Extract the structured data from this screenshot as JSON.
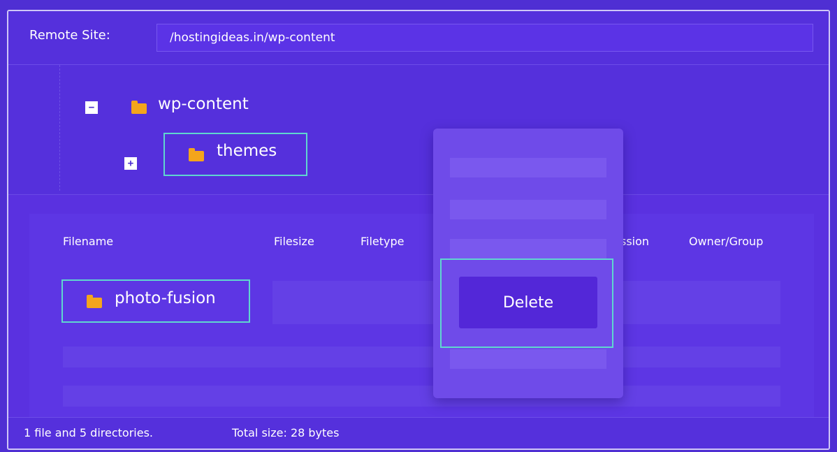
{
  "remote_site": {
    "label": "Remote Site:",
    "path": "/hostingideas.in/wp-content"
  },
  "tree": {
    "root": {
      "toggle": "−",
      "label": "wp-content",
      "icon": "folder-icon"
    },
    "child": {
      "toggle": "+",
      "label": "themes",
      "icon": "folder-icon"
    }
  },
  "file_list": {
    "columns": [
      "Filename",
      "Filesize",
      "Filetype",
      "ssion",
      "Owner/Group"
    ],
    "rows": [
      {
        "filename": "photo-fusion",
        "icon": "folder-icon"
      }
    ]
  },
  "context_menu": {
    "delete_label": "Delete"
  },
  "status": {
    "summary": "1 file and 5 directories.",
    "total": "Total size: 28 bytes"
  },
  "colors": {
    "background": "#4f2fd3",
    "panel": "#5a31e0",
    "highlight": "#5fd6cf",
    "folder": "#f4a51c",
    "delete_button": "#5327d8"
  }
}
